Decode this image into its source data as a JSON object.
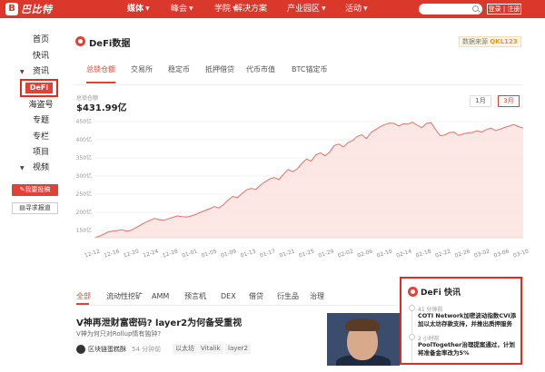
{
  "brand": {
    "logo_text": "巴比特",
    "logo_mark": "B"
  },
  "nav": {
    "items": [
      {
        "label": "媒体",
        "caret": true,
        "active": true
      },
      {
        "label": "峰会",
        "caret": true,
        "active": false
      },
      {
        "label": "学院",
        "caret": true,
        "active": false
      },
      {
        "label": "解决方案",
        "caret": false,
        "active": false
      },
      {
        "label": "产业园区",
        "caret": true,
        "active": false
      },
      {
        "label": "活动",
        "caret": true,
        "active": false
      }
    ],
    "login_label": "登录 | 注册"
  },
  "sidebar": {
    "items": [
      "首页",
      "快讯",
      "资讯",
      "DeFi",
      "海盗号",
      "专题",
      "专栏",
      "项目",
      "视频"
    ],
    "active": "DeFi",
    "contribute_label": "我要投稿",
    "report_label": "寻求报道"
  },
  "header": {
    "title": "DeFi数据",
    "source_prefix": "数据来源",
    "source_name": "QKL123"
  },
  "tabs": [
    "总锁仓额",
    "交易所",
    "稳定币",
    "抵押借贷",
    "代币市值",
    "BTC锚定币"
  ],
  "active_tab": "总锁仓额",
  "kpi": {
    "label": "总锁仓额",
    "value": "$431.99亿"
  },
  "ranges": [
    "1月",
    "3月"
  ],
  "active_range": "3月",
  "colors": {
    "accent": "#e24235",
    "line": "#e0736a",
    "fill": "#fbe3e0"
  },
  "chart_data": {
    "type": "area",
    "ylabels": [
      "450亿",
      "400亿",
      "350亿",
      "300亿",
      "250亿",
      "200亿",
      "150亿"
    ],
    "ylim": [
      130,
      460
    ],
    "xlabels": [
      "12-12",
      "12-16",
      "12-20",
      "12-24",
      "12-28",
      "01-01",
      "01-05",
      "01-09",
      "01-13",
      "01-17",
      "01-21",
      "01-25",
      "01-29",
      "02-02",
      "02-06",
      "02-10",
      "02-14",
      "02-18",
      "02-22",
      "02-26",
      "03-02",
      "03-06",
      "03-10"
    ],
    "values": [
      130,
      134,
      140,
      146,
      148,
      150,
      152,
      148,
      151,
      158,
      165,
      172,
      178,
      183,
      180,
      178,
      182,
      186,
      190,
      188,
      187,
      190,
      194,
      200,
      205,
      210,
      216,
      212,
      221,
      234,
      244,
      240,
      252,
      262,
      266,
      263,
      275,
      284,
      292,
      296,
      290,
      305,
      318,
      312,
      320,
      335,
      347,
      341,
      358,
      364,
      356,
      366,
      384,
      388,
      380,
      392,
      398,
      409,
      414,
      403,
      420,
      428,
      436,
      442,
      446,
      445,
      438,
      444,
      443,
      448,
      440,
      433,
      445,
      447,
      428,
      411,
      413,
      420,
      421,
      412,
      416,
      419,
      420,
      425,
      421,
      428,
      432,
      425,
      429,
      434,
      438,
      442,
      436,
      432
    ]
  },
  "bottom_tabs": [
    "全部",
    "流动性挖矿",
    "AMM",
    "预言机",
    "DEX",
    "借贷",
    "衍生品",
    "治理"
  ],
  "article": {
    "title": "V神再泄财富密码? layer2为何备受重视",
    "subtitle": "V神为何只对Rollup情有独钟?",
    "author": "区块链蛋糕酥",
    "time": "54 分钟前",
    "tags": [
      "以太坊",
      "Vitalik",
      "layer2"
    ]
  },
  "news": {
    "title": "DeFi 快讯",
    "items": [
      {
        "time": "41 分钟前",
        "text": "COTI Network加密波动指数CVI添加以太坊存款支持，并推出质押服务"
      },
      {
        "time": "2 小时前",
        "text": "PoolTogether治理提案通过，计划将准备金率改为5%"
      }
    ]
  }
}
